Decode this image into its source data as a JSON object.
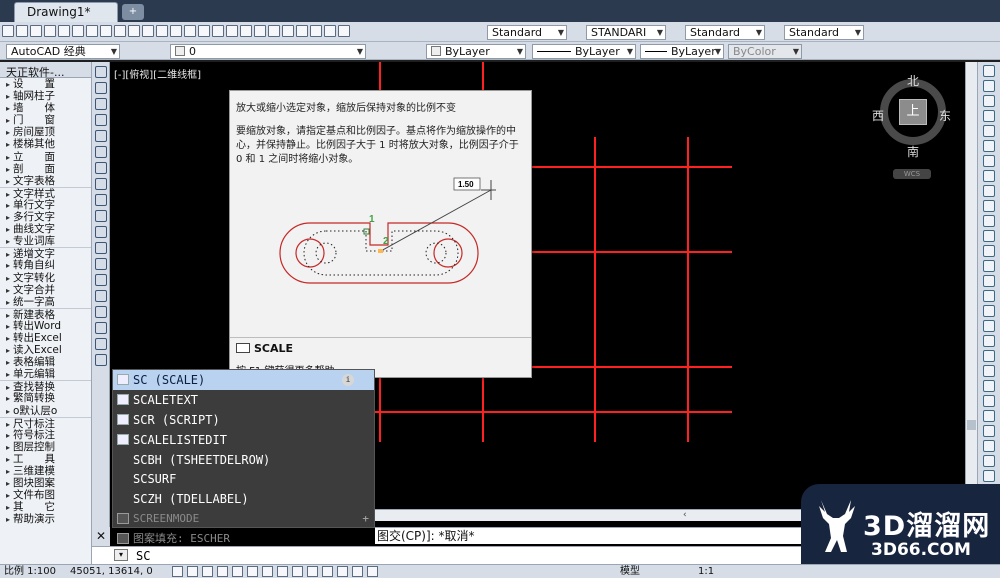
{
  "window": {
    "tab_title": "Drawing1*",
    "new_tab_icon": "new-tab-icon"
  },
  "toolbar_top": {
    "text_style": "Standard",
    "dim_style": "STANDARI",
    "table_style": "Standard",
    "multileader_style": "Standard"
  },
  "toolbar_props": {
    "workspace": "AutoCAD 经典",
    "layer_name": "0",
    "color": "ByLayer",
    "linetype": "ByLayer",
    "lineweight": "ByLayer",
    "plotstyle": "ByColor"
  },
  "tz_panel": {
    "title": "天正软件-...",
    "items": [
      {
        "label": "设　　置",
        "section": false
      },
      {
        "label": "轴网柱子",
        "section": false
      },
      {
        "label": "墙　　体",
        "section": false
      },
      {
        "label": "门　　窗",
        "section": false
      },
      {
        "label": "房间屋顶",
        "section": false
      },
      {
        "label": "楼梯其他",
        "section": false
      },
      {
        "label": "立　　面",
        "section": false
      },
      {
        "label": "剖　　面",
        "section": false
      },
      {
        "label": "文字表格",
        "section": false
      },
      {
        "label": "文字样式",
        "section": true
      },
      {
        "label": "单行文字",
        "section": false
      },
      {
        "label": "多行文字",
        "section": false
      },
      {
        "label": "曲线文字",
        "section": false
      },
      {
        "label": "专业词库",
        "section": false
      },
      {
        "label": "递增文字",
        "section": true
      },
      {
        "label": "转角自纠",
        "section": false
      },
      {
        "label": "文字转化",
        "section": false
      },
      {
        "label": "文字合并",
        "section": false
      },
      {
        "label": "统一字高",
        "section": false
      },
      {
        "label": "新建表格",
        "section": true
      },
      {
        "label": "转出Word",
        "section": false
      },
      {
        "label": "转出Excel",
        "section": false
      },
      {
        "label": "读入Excel",
        "section": false
      },
      {
        "label": "表格编辑",
        "section": false
      },
      {
        "label": "单元编辑",
        "section": false
      },
      {
        "label": "查找替换",
        "section": true
      },
      {
        "label": "繁简转换",
        "section": false
      },
      {
        "label": "o默认层o",
        "section": false
      },
      {
        "label": "尺寸标注",
        "section": true
      },
      {
        "label": "符号标注",
        "section": false
      },
      {
        "label": "图层控制",
        "section": false
      },
      {
        "label": "工　　具",
        "section": false
      },
      {
        "label": "三维建模",
        "section": false
      },
      {
        "label": "图块图案",
        "section": false
      },
      {
        "label": "文件布图",
        "section": false
      },
      {
        "label": "其　　它",
        "section": false
      },
      {
        "label": "帮助演示",
        "section": false
      }
    ]
  },
  "canvas": {
    "viewport_label": "[-][俯视][二维线框]",
    "compass": {
      "north": "北",
      "south": "南",
      "east": "东",
      "west": "西",
      "cube": "上",
      "wcs": "WCS"
    },
    "line_color": "#ff2020"
  },
  "tooltip": {
    "description": "放大或缩小选定对象，缩放后保持对象的比例不变",
    "body": "要缩放对象，请指定基点和比例因子。基点将作为缩放操作的中心，并保持静止。比例因子大于 1 时将放大对象，比例因子介于 0 和 1 之间时将缩小对象。",
    "illus_factor": "1.50",
    "illus_p1": "1",
    "illus_p2": "2",
    "command": "SCALE",
    "help": "按 F1 键获得更多帮助"
  },
  "autocomplete": {
    "items": [
      {
        "label": "SC (SCALE)",
        "icon": "scale-icon"
      },
      {
        "label": "SCALETEXT",
        "icon": "scaletext-icon"
      },
      {
        "label": "SCR (SCRIPT)",
        "icon": "script-icon"
      },
      {
        "label": "SCALELISTEDIT",
        "icon": "scalelist-icon"
      },
      {
        "label": "SCBH (TSHEETDELROW)",
        "icon": ""
      },
      {
        "label": "SCSURF",
        "icon": ""
      },
      {
        "label": "SCZH (TDELLABEL)",
        "icon": ""
      }
    ],
    "system_variable": "SCREENMODE",
    "hatch": "图案填充: ESCHER"
  },
  "command_line": {
    "history": "图交(CP)]: *取消*",
    "input_value": "SC"
  },
  "status": {
    "scale": "比例 1:100",
    "coords": "45051, 13614, 0",
    "model": "模型",
    "ratio": "1:1"
  },
  "watermark": {
    "title": "3D溜溜网",
    "url": "3D66.COM"
  }
}
